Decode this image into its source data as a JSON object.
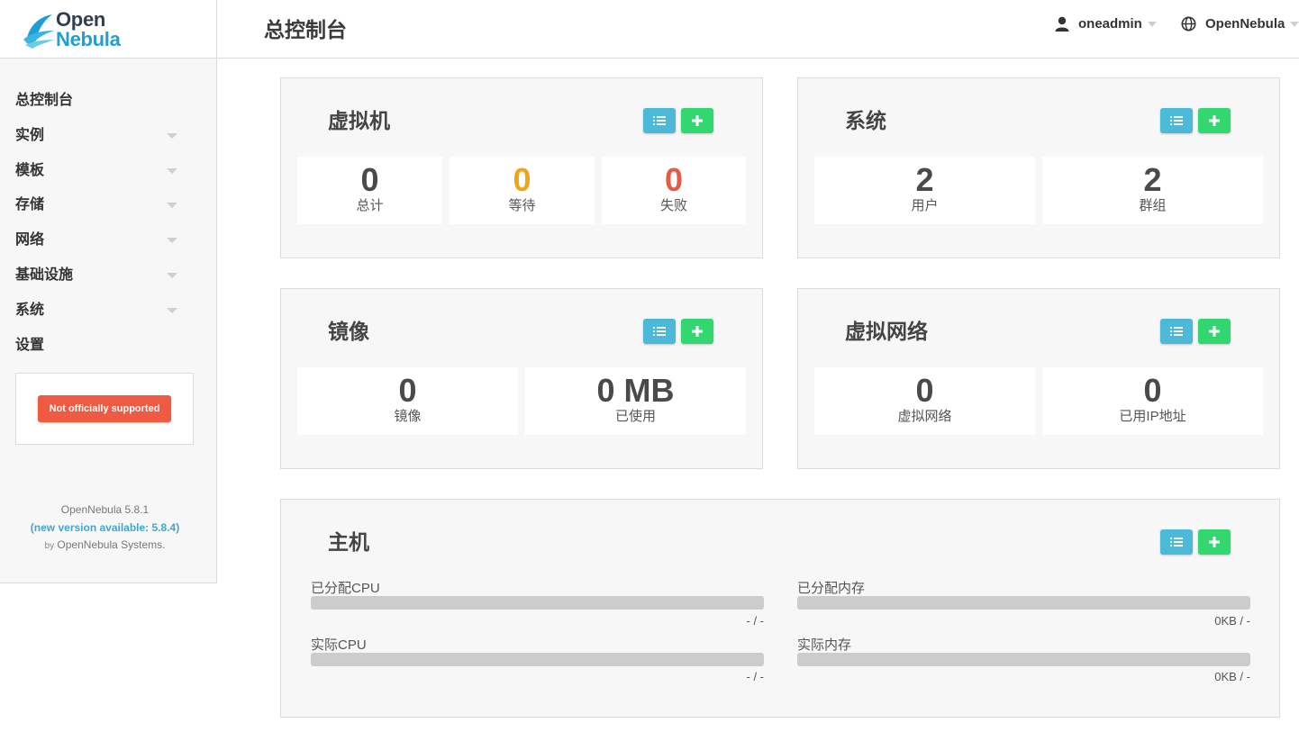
{
  "logo": {
    "line1": "Open",
    "line2": "Nebula"
  },
  "header": {
    "title": "总控制台",
    "user": "oneadmin",
    "zone": "OpenNebula"
  },
  "sidebar": {
    "items": [
      {
        "label": "总控制台",
        "has_caret": false
      },
      {
        "label": "实例",
        "has_caret": true
      },
      {
        "label": "模板",
        "has_caret": true
      },
      {
        "label": "存储",
        "has_caret": true
      },
      {
        "label": "网络",
        "has_caret": true
      },
      {
        "label": "基础设施",
        "has_caret": true
      },
      {
        "label": "系统",
        "has_caret": true
      },
      {
        "label": "设置",
        "has_caret": false
      }
    ],
    "support_button": "Not officially supported",
    "version": "OpenNebula 5.8.1",
    "new_version": "(new version available: 5.8.4)",
    "by": "by",
    "vendor": "OpenNebula Systems."
  },
  "panels": {
    "vms": {
      "title": "虚拟机",
      "stats": [
        {
          "value": "0",
          "label": "总计"
        },
        {
          "value": "0",
          "label": "等待"
        },
        {
          "value": "0",
          "label": "失败"
        }
      ]
    },
    "system": {
      "title": "系统",
      "stats": [
        {
          "value": "2",
          "label": "用户"
        },
        {
          "value": "2",
          "label": "群组"
        }
      ]
    },
    "images": {
      "title": "镜像",
      "stats": [
        {
          "value": "0",
          "label": "镜像"
        },
        {
          "value": "0 MB",
          "label": "已使用"
        }
      ]
    },
    "vnets": {
      "title": "虚拟网络",
      "stats": [
        {
          "value": "0",
          "label": "虚拟网络"
        },
        {
          "value": "0",
          "label": "已用IP地址"
        }
      ]
    },
    "hosts": {
      "title": "主机",
      "bars": [
        {
          "label": "已分配CPU",
          "value": "- / -"
        },
        {
          "label": "已分配内存",
          "value": "0KB / -"
        },
        {
          "label": "实际CPU",
          "value": "- / -"
        },
        {
          "label": "实际内存",
          "value": "0KB / -"
        }
      ]
    }
  },
  "colors": {
    "list_button": "#4db9d8",
    "add_button": "#33d76f",
    "pending": "#f2a31c",
    "failed": "#e45a42",
    "support_button": "#ee5a42"
  }
}
